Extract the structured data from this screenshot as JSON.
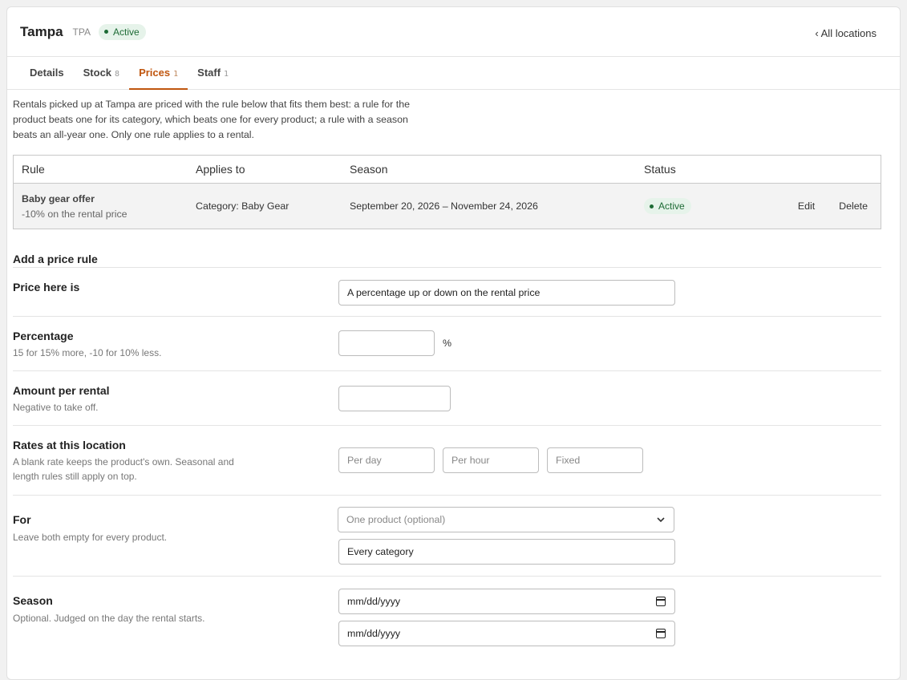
{
  "header": {
    "title": "Tampa",
    "code": "TPA",
    "status": "Active",
    "back_link": "‹ All locations"
  },
  "tabs": [
    {
      "label": "Details",
      "count": ""
    },
    {
      "label": "Stock",
      "count": "8"
    },
    {
      "label": "Prices",
      "count": "1"
    },
    {
      "label": "Staff",
      "count": "1"
    }
  ],
  "intro": "Rentals picked up at Tampa are priced with the rule below that fits them best: a rule for the product beats one for its category, which beats one for every product; a rule with a season beats an all-year one. Only one rule applies to a rental.",
  "table": {
    "headers": {
      "rule": "Rule",
      "applies": "Applies to",
      "season": "Season",
      "status": "Status"
    },
    "rows": [
      {
        "name": "Baby gear offer",
        "description": "-10% on the rental price",
        "applies": "Category: Baby Gear",
        "season": "September 20, 2026 – November 24, 2026",
        "status": "Active",
        "edit": "Edit",
        "delete": "Delete"
      }
    ]
  },
  "form": {
    "title": "Add a price rule",
    "price_type": {
      "label": "Price here is",
      "value": "A percentage up or down on the rental price"
    },
    "percentage": {
      "label": "Percentage",
      "hint": "15 for 15% more, -10 for 10% less.",
      "value": "",
      "unit": "%"
    },
    "amount": {
      "label": "Amount per rental",
      "hint": "Negative to take off.",
      "value": ""
    },
    "rates": {
      "label": "Rates at this location",
      "hint": "A blank rate keeps the product's own. Seasonal and length rules still apply on top.",
      "per_day_placeholder": "Per day",
      "per_hour_placeholder": "Per hour",
      "fixed_placeholder": "Fixed"
    },
    "for": {
      "label": "For",
      "hint": "Leave both empty for every product.",
      "product_placeholder": "One product (optional)",
      "category_value": "Every category"
    },
    "season": {
      "label": "Season",
      "hint": "Optional. Judged on the day the rental starts.",
      "start_placeholder": "mm/dd/yyyy",
      "end_placeholder": "mm/dd/yyyy"
    }
  },
  "colors": {
    "accent": "#c0560f",
    "active_bg": "#e6f3ea",
    "active_text": "#1d6b35"
  }
}
